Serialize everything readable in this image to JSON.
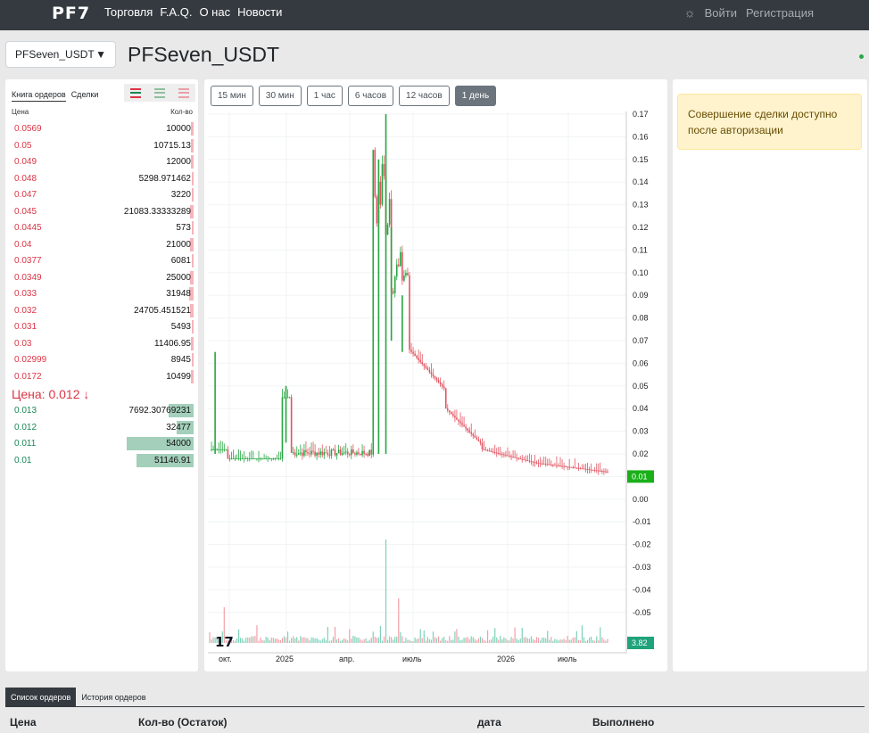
{
  "nav": {
    "logo": "PF7",
    "links": [
      "Торговля",
      "F.A.Q.",
      "О нас",
      "Новости"
    ],
    "login": "Войти",
    "register": "Регистрация",
    "theme_icon": "sun-icon"
  },
  "pair": {
    "selected": "PFSeven_USDT",
    "title": "PFSeven_USDT"
  },
  "book": {
    "tabs": [
      "Книга ордеров",
      "Сделки"
    ],
    "head_price": "Цена",
    "head_qty": "Кол-во",
    "asks": [
      {
        "price": "0.0569",
        "qty": "10000",
        "level": 0.04
      },
      {
        "price": "0.05",
        "qty": "10715.13",
        "level": 0.04
      },
      {
        "price": "0.049",
        "qty": "12000",
        "level": 0.04
      },
      {
        "price": "0.048",
        "qty": "5298.971462",
        "level": 0.02
      },
      {
        "price": "0.047",
        "qty": "3220",
        "level": 0.02
      },
      {
        "price": "0.045",
        "qty": "21083.33333289",
        "level": 0.05
      },
      {
        "price": "0.0445",
        "qty": "573",
        "level": 0.01
      },
      {
        "price": "0.04",
        "qty": "21000",
        "level": 0.05
      },
      {
        "price": "0.0377",
        "qty": "6081",
        "level": 0.02
      },
      {
        "price": "0.0349",
        "qty": "25000",
        "level": 0.06
      },
      {
        "price": "0.033",
        "qty": "31948",
        "level": 0.07
      },
      {
        "price": "0.032",
        "qty": "24705.451521",
        "level": 0.06
      },
      {
        "price": "0.031",
        "qty": "5493",
        "level": 0.02
      },
      {
        "price": "0.03",
        "qty": "11406.95",
        "level": 0.04
      },
      {
        "price": "0.02999",
        "qty": "8945",
        "level": 0.03
      },
      {
        "price": "0.0172",
        "qty": "10499",
        "level": 0.04
      }
    ],
    "last_price": "Цена: 0.012 ↓",
    "bids": [
      {
        "price": "0.013",
        "qty": "7692.30769231",
        "level": 0.37
      },
      {
        "price": "0.012",
        "qty": "32477",
        "level": 0.26
      },
      {
        "price": "0.011",
        "qty": "54000",
        "level": 1.0
      },
      {
        "price": "0.01",
        "qty": "51146.91",
        "level": 0.86
      }
    ]
  },
  "timeframes": [
    {
      "label": "15 мин",
      "active": false
    },
    {
      "label": "30 мин",
      "active": false
    },
    {
      "label": "1 час",
      "active": false
    },
    {
      "label": "6 часов",
      "active": false
    },
    {
      "label": "12 часов",
      "active": false
    },
    {
      "label": "1 день",
      "active": true
    }
  ],
  "chart": {
    "price_ticks": [
      "0.17",
      "0.16",
      "0.15",
      "0.14",
      "0.13",
      "0.12",
      "0.11",
      "0.10",
      "0.09",
      "0.08",
      "0.07",
      "0.06",
      "0.05",
      "0.04",
      "0.03",
      "0.02",
      "0.01",
      "0.00",
      "-0.01",
      "-0.02",
      "-0.03",
      "-0.04",
      "-0.05"
    ],
    "time_ticks": [
      "окт.",
      "2025",
      "апр.",
      "июль",
      "2026",
      "июль"
    ],
    "last_price_badge": "0.01",
    "last_volume_badge": "3.82",
    "up_color": "#26a641",
    "down_color": "#e05561",
    "logo_icon": "tradingview-logo-icon"
  },
  "auth_notice": "Совершение сделки доступно после авторизации",
  "bottom": {
    "tabs": [
      "Список ордеров",
      "История ордеров"
    ],
    "columns": [
      "Цена",
      "Кол-во (Остаток)",
      "дата",
      "Выполнено"
    ]
  }
}
